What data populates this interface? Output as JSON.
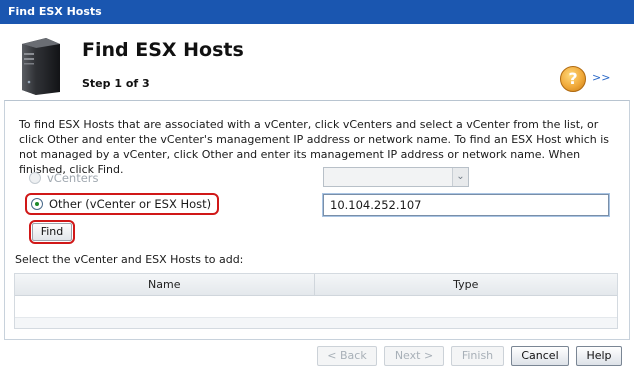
{
  "window": {
    "title": "Find ESX Hosts"
  },
  "header": {
    "title": "Find ESX Hosts",
    "step": "Step 1 of 3",
    "help_icon_glyph": "?",
    "expand_label": ">>"
  },
  "content": {
    "instructions": "To find ESX Hosts that are associated with a vCenter, click vCenters and select a vCenter from the list, or click Other and enter the vCenter's management IP address or network name. To find an ESX Host which is not managed by a vCenter, click Other and enter its management IP address or network name. When finished, click Find.",
    "options": {
      "vcenters_label": "vCenters",
      "other_label": "Other (vCenter or ESX Host)",
      "selected": "other"
    },
    "vcenter_select": {
      "value": "",
      "arrow": "⌄"
    },
    "ip_input": {
      "value": "10.104.252.107"
    },
    "find_label": "Find",
    "select_label": "Select the vCenter and ESX Hosts to add:",
    "table": {
      "columns": [
        "Name",
        "Type"
      ],
      "rows": []
    }
  },
  "footer": {
    "back_label": "< Back",
    "next_label": "Next >",
    "finish_label": "Finish",
    "cancel_label": "Cancel",
    "help_label": "Help"
  },
  "colors": {
    "titlebar": "#1a56b0",
    "highlight_red": "#d01818",
    "link_blue": "#2a68c8"
  },
  "icons": {
    "server": "server-tower-icon",
    "help": "help-question-icon",
    "dropdown": "chevron-down-icon"
  }
}
